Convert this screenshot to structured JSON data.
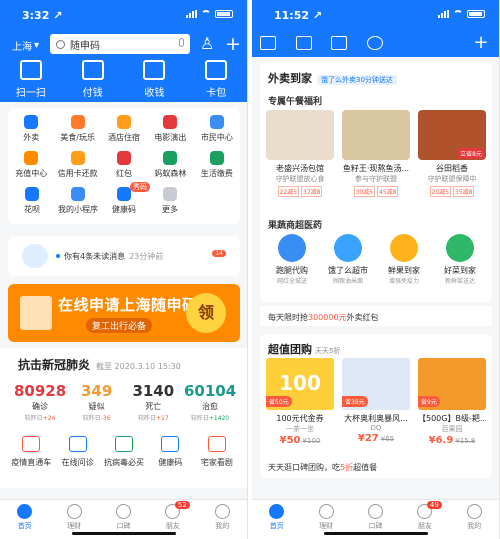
{
  "left": {
    "status": {
      "time": "3:32 ↗"
    },
    "header": {
      "city": "上海",
      "search_text": "随申码",
      "big_actions": [
        {
          "label": "扫一扫",
          "icon": "scan-icon"
        },
        {
          "label": "付钱",
          "icon": "pay-code-icon"
        },
        {
          "label": "收钱",
          "icon": "receive-money-icon"
        },
        {
          "label": "卡包",
          "icon": "card-wallet-icon"
        }
      ]
    },
    "grid": [
      [
        "外卖",
        "美食/玩乐",
        "酒店住宿",
        "电影演出",
        "市民中心"
      ],
      [
        "充值中心",
        "信用卡还款",
        "红包",
        "蚂蚁森林",
        "生活缴费"
      ],
      [
        "花呗",
        "我的小程序",
        "健康码",
        "更多"
      ]
    ],
    "grid_tag": "秀码",
    "message": {
      "text": "你有4条未读消息",
      "time": "23分钟前",
      "count": "14"
    },
    "banner": {
      "title": "在线申请上海随申码",
      "subtitle": "复工出行必备",
      "button": "领"
    },
    "covid": {
      "title": "抗击新冠肺炎",
      "date": "截至 2020.3.10 15:30",
      "stats": [
        {
          "value": "80928",
          "label": "确诊",
          "delta_label": "较昨日",
          "delta": "+24",
          "color": "#e4393c"
        },
        {
          "value": "349",
          "label": "疑似",
          "delta_label": "较昨日",
          "delta": "-36",
          "color": "#f29b34"
        },
        {
          "value": "3140",
          "label": "死亡",
          "delta_label": "较昨日",
          "delta": "+17",
          "color": "#333333"
        },
        {
          "value": "60104",
          "label": "治愈",
          "delta_label": "较昨日",
          "delta": "+1420",
          "color": "#1a9a8a"
        }
      ],
      "actions": [
        "疫情直通车",
        "在线问诊",
        "抗病毒必买",
        "健康码",
        "宅家看剧"
      ]
    },
    "tabs": [
      {
        "label": "首页",
        "active": true
      },
      {
        "label": "理财"
      },
      {
        "label": "口碑"
      },
      {
        "label": "朋友",
        "badge": "52"
      },
      {
        "label": "我的"
      }
    ]
  },
  "right": {
    "status": {
      "time": "11:52 ↗"
    },
    "waimai": {
      "title": "外卖到家",
      "tag": "饿了么外卖30分钟送达",
      "section1": "专属午餐福利",
      "foods": [
        {
          "name": "老盛兴汤包馆",
          "sub": "守护联盟放心食",
          "coupons": [
            "22减5",
            "37减8"
          ]
        },
        {
          "name": "鱼籽王·现熬鱼汤...",
          "sub": "参与守护联盟",
          "coupons": [
            "30减5",
            "45减8"
          ]
        },
        {
          "name": "谷田稻香",
          "sub": "守护联盟保障中",
          "coupons": [
            "20减5",
            "35减8"
          ]
        }
      ],
      "food_badge": "立省8元",
      "section2": "果蔬商超医药",
      "cats": [
        {
          "name": "跑腿代购",
          "sub": "网红全城送"
        },
        {
          "name": "饿了么超市",
          "sub": "囤粮油米面"
        },
        {
          "name": "鲜果到家",
          "sub": "增强免疫力"
        },
        {
          "name": "好菜到家",
          "sub": "新鲜菜送达"
        }
      ]
    },
    "limit": {
      "pre": "每天限时抢",
      "amount": "300000元",
      "post": "外卖红包"
    },
    "tuan": {
      "title": "超值团购",
      "sub": "天天5折",
      "deals": [
        {
          "save": "省50元",
          "name": "100元代金券",
          "sub": "一茶一坐",
          "price": "¥50",
          "old": "¥100"
        },
        {
          "save": "省38元",
          "name": "大杯奥利奥暴风...",
          "sub": "DQ",
          "price": "¥27",
          "old": "¥65"
        },
        {
          "save": "省9元",
          "name": "【500G】B级-耙...",
          "sub": "百果园",
          "price": "¥6.9",
          "old": "¥15.8"
        }
      ],
      "deal_img_text": "100",
      "foot_pre": "天天逛口碑团购，吃",
      "foot_hl": "5折",
      "foot_post": "超值餐"
    },
    "tabs": [
      {
        "label": "首页",
        "active": true
      },
      {
        "label": "理财"
      },
      {
        "label": "口碑"
      },
      {
        "label": "朋友",
        "badge": "49"
      },
      {
        "label": "我的"
      }
    ]
  },
  "colors": {
    "brand_blue": "#1677ff",
    "alert_red": "#ff5a3c",
    "banner_orange": "#ff8a00"
  }
}
